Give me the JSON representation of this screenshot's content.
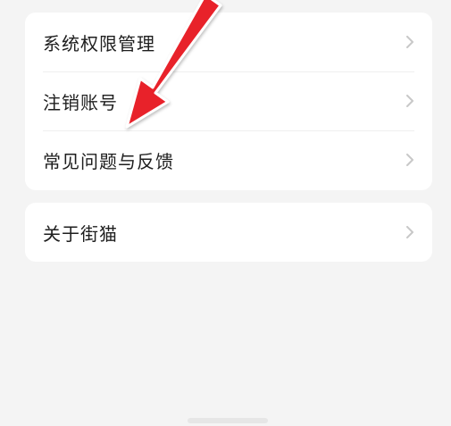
{
  "settings_card": {
    "items": [
      {
        "label": "系统权限管理",
        "icon": "chevron-right-icon"
      },
      {
        "label": "注销账号",
        "icon": "chevron-right-icon"
      },
      {
        "label": "常见问题与反馈",
        "icon": "chevron-right-icon"
      }
    ]
  },
  "about_card": {
    "items": [
      {
        "label": "关于街猫",
        "icon": "chevron-right-icon"
      }
    ]
  },
  "colors": {
    "background": "#f4f4f4",
    "card": "#ffffff",
    "text": "#1e1e1e",
    "chevron": "#c8c8c8",
    "annotation_arrow": "#e8202a"
  }
}
